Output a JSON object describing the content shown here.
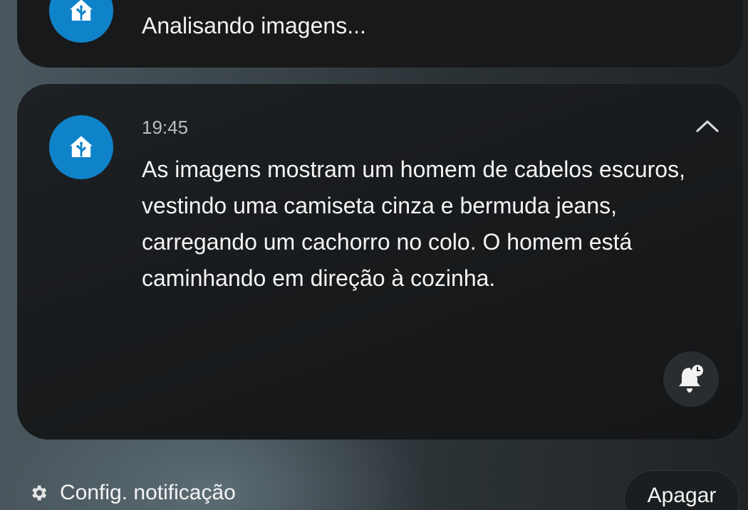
{
  "previous_notification": {
    "app_icon": "home-assistant-icon",
    "text": "Analisando imagens..."
  },
  "notification": {
    "app_icon": "home-assistant-icon",
    "time": "19:45",
    "expand_icon": "chevron-up-icon",
    "message": "As imagens mostram um homem de cabelos escuros, vestindo uma camiseta cinza e bermuda jeans, carregando um cachorro no colo. O homem está caminhando em direção à cozinha.",
    "snooze_icon": "bell-snooze-icon"
  },
  "footer": {
    "settings_icon": "gear-icon",
    "settings_label": "Config. notificação",
    "clear_label": "Apagar"
  },
  "colors": {
    "accent": "#0f83c9",
    "card": "#17191b"
  }
}
